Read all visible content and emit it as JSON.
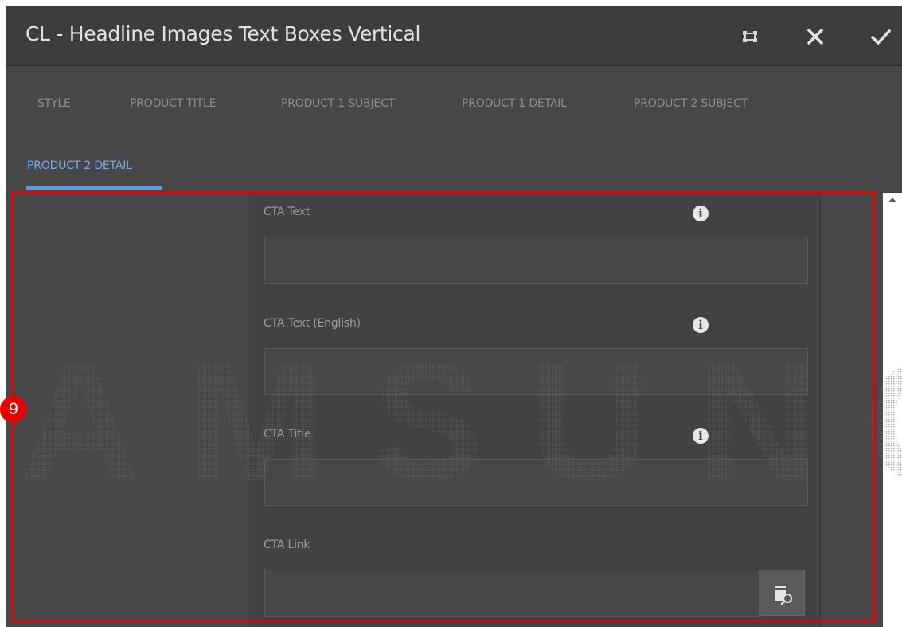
{
  "dialog": {
    "title": "CL - Headline Images Text Boxes Vertical",
    "buttons": {
      "fullscreen": "fullscreen-icon",
      "close": "close-icon",
      "confirm": "checkmark-icon"
    }
  },
  "tabs": [
    {
      "label": "STYLE",
      "active": false
    },
    {
      "label": "PRODUCT TITLE",
      "active": false
    },
    {
      "label": "PRODUCT 1 SUBJECT",
      "active": false
    },
    {
      "label": "PRODUCT 1 DETAIL",
      "active": false
    },
    {
      "label": "PRODUCT 2 SUBJECT",
      "active": false
    },
    {
      "label": "PRODUCT 2 DETAIL",
      "active": true
    }
  ],
  "fields": [
    {
      "label": "CTA Text",
      "value": "",
      "info_icon": "info-icon"
    },
    {
      "label": "CTA Text (English)",
      "value": "",
      "info_icon": "info-icon"
    },
    {
      "label": "CTA Title",
      "value": "",
      "info_icon": "info-icon"
    },
    {
      "label": "CTA Link",
      "value": "",
      "action_icon": "path-browser-icon"
    }
  ],
  "annotation": {
    "step_number": "9",
    "highlight_color": "#e60000"
  },
  "watermark": {
    "text": "SAMSUNG"
  },
  "colors": {
    "dialog_bg": "#474747",
    "titlebar_bg": "#3d3d3d",
    "active_tab": "#5b9be8",
    "form_bg": "#424242"
  }
}
